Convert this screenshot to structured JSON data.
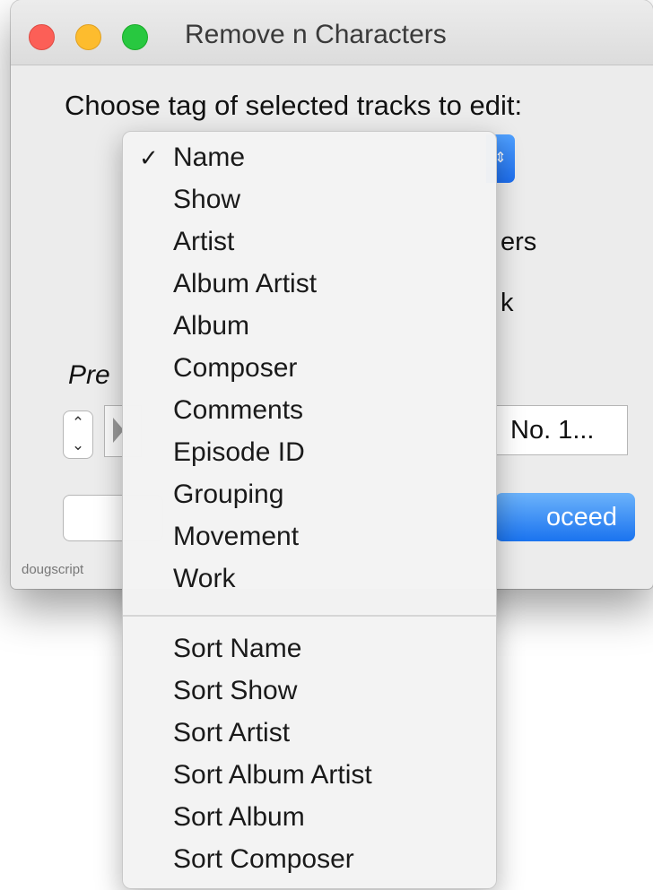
{
  "window": {
    "title": "Remove n Characters",
    "prompt": "Choose tag of selected tracks to edit:",
    "partial_text_1": "ers",
    "partial_text_2": "k",
    "preview_label": "Pre",
    "preview_value": "No. 1...",
    "proceed_label": "oceed",
    "footer": "dougscript"
  },
  "menu": {
    "selected": "Name",
    "items": [
      {
        "label": "Name",
        "checked": "✓"
      },
      {
        "label": "Show"
      },
      {
        "label": "Artist"
      },
      {
        "label": "Album Artist"
      },
      {
        "label": "Album"
      },
      {
        "label": "Composer"
      },
      {
        "label": "Comments"
      },
      {
        "label": "Episode ID"
      },
      {
        "label": "Grouping"
      },
      {
        "label": "Movement"
      },
      {
        "label": "Work"
      }
    ],
    "sort_items": [
      {
        "label": "Sort Name"
      },
      {
        "label": "Sort Show"
      },
      {
        "label": "Sort Artist"
      },
      {
        "label": "Sort Album Artist"
      },
      {
        "label": "Sort Album"
      },
      {
        "label": "Sort Composer"
      }
    ]
  },
  "colors": {
    "close": "#fc5f57",
    "minimize": "#fdbc2e",
    "zoom": "#28c840",
    "accent": "#1a73ef"
  },
  "icons": {
    "checkmark": "checkmark-icon",
    "stepper": "stepper-icon",
    "play": "play-icon",
    "popup": "popup-arrows-icon"
  }
}
